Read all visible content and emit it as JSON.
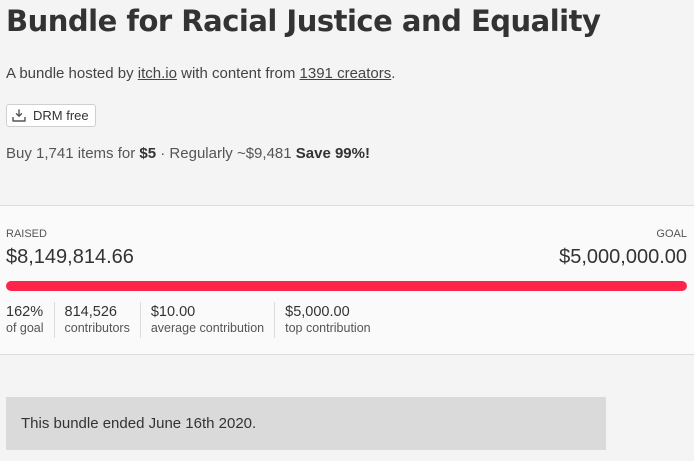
{
  "bundle": {
    "title": "Bundle for Racial Justice and Equality",
    "host_prefix": "A bundle hosted by ",
    "host_link": "itch.io",
    "host_middle": " with content from ",
    "creators_link": "1391 creators",
    "host_suffix": ".",
    "drm_label": "DRM free",
    "drm_icon": "download-icon"
  },
  "pricing": {
    "prefix": "Buy 1,741 items for ",
    "price": "$5",
    "regular": " · Regularly ~$9,481 ",
    "save": "Save 99%!"
  },
  "stats": {
    "raised_label": "RAISED",
    "raised_value": "$8,149,814.66",
    "goal_label": "GOAL",
    "goal_value": "$5,000,000.00",
    "progress_fraction": 1.0,
    "progress_color": "#ff2449",
    "columns": [
      {
        "value": "162%",
        "label": "of goal"
      },
      {
        "value": "814,526",
        "label": "contributors"
      },
      {
        "value": "$10.00",
        "label": "average contribution"
      },
      {
        "value": "$5,000.00",
        "label": "top contribution"
      }
    ]
  },
  "status": {
    "ended_text": "This bundle ended June 16th 2020."
  }
}
